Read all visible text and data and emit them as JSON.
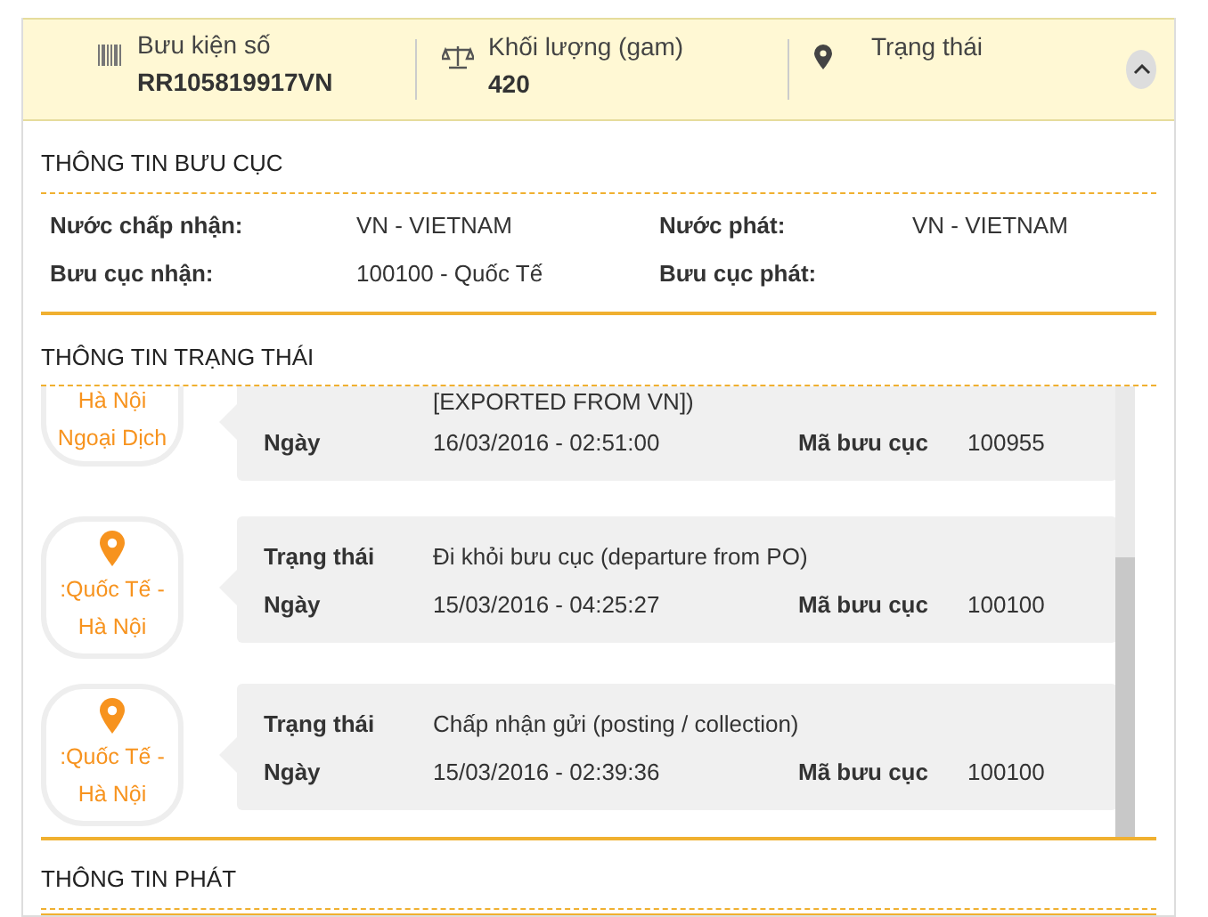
{
  "shipment": {
    "expanded": true,
    "fields": [
      {
        "kind": "barcode",
        "label": "Bưu kiện số",
        "value": "RR105819917VN"
      },
      {
        "kind": "weight",
        "label": "Khối lượng (gam)",
        "value": "420"
      },
      {
        "kind": "location",
        "label": "Trạng thái"
      }
    ]
  },
  "post_office": {
    "title": "THÔNG TIN BƯU CỤC",
    "rows": [
      [
        {
          "label": "Nước chấp nhận:",
          "value": "VN - VIETNAM"
        },
        {
          "label": "Nước phát:",
          "value": "VN - VIETNAM"
        }
      ],
      [
        {
          "label": "Bưu cục nhận:",
          "value": "100100 - Quốc Tế"
        },
        {
          "label": "Bưu cục phát:"
        }
      ]
    ]
  },
  "status": {
    "title": "THÔNG TIN TRẠNG THÁI",
    "events": [
      {
        "kind": "partial",
        "station": "Hà Nội Ngoại Dịch",
        "status": "[EXPORTED FROM VN])",
        "date_label": "Ngày",
        "date": "16/03/2016 - 02:51:00",
        "code_label": "Mã bưu cục",
        "code": "100955"
      },
      {
        "kind": "full",
        "station": ":Quốc Tế - Hà Nội",
        "status_label": "Trạng thái",
        "status": "Đi khỏi bưu cục (departure from PO)",
        "date_label": "Ngày",
        "date": "15/03/2016 - 04:25:27",
        "code_label": "Mã bưu cục",
        "code": "100100"
      },
      {
        "kind": "full",
        "station": ":Quốc Tế - Hà Nội",
        "status_label": "Trạng thái",
        "status": "Chấp nhận gửi (posting / collection)",
        "date_label": "Ngày",
        "date": "15/03/2016 - 02:39:36",
        "code_label": "Mã bưu cục",
        "code": "100100"
      }
    ]
  },
  "delivery": {
    "title": "THÔNG TIN PHÁT"
  }
}
